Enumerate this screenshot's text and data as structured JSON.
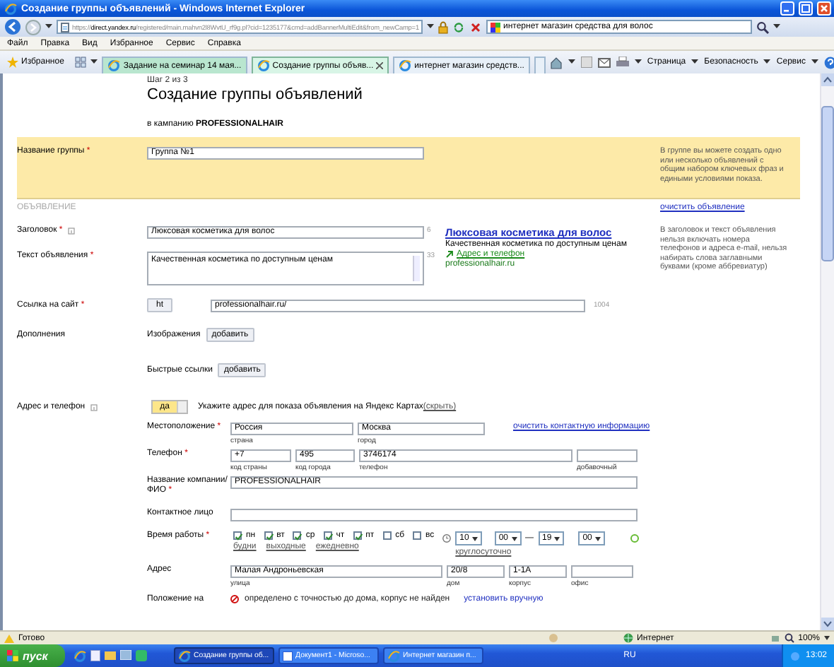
{
  "window": {
    "title": "Создание группы объявлений - Windows Internet Explorer"
  },
  "address_bar": {
    "url_prefix": "https://",
    "url_host": "direct.yandex.ru",
    "url_rest": "/registered/main.mahvn2l8WvtU_rf9g.pl?cid=1235177&cmd=addBannerMultiEdit&from_newCamp=1",
    "search": "интернет магазин средства для волос"
  },
  "menu": [
    "Файл",
    "Правка",
    "Вид",
    "Избранное",
    "Сервис",
    "Справка"
  ],
  "favorites": {
    "label": "Избранное"
  },
  "tabs": [
    {
      "label": "Задание на семинар 14 мая...",
      "selected": false
    },
    {
      "label": "Создание группы объяв...",
      "selected": true
    },
    {
      "label": "интернет магазин средств...",
      "selected": false
    }
  ],
  "command_bar": [
    "Страница",
    "Безопасность",
    "Сервис"
  ],
  "form": {
    "step": "Шаг 2 из 3",
    "heading": "Создание группы объявлений",
    "campaign": "в кампанию **PROFESSIONALHAIR**",
    "group": {
      "label": "Название группы",
      "req": "*",
      "value": "Группа №1",
      "hint": "В группе вы можете создать одно или несколько объявлений с общим набором ключевых фраз и едиными условиями показа."
    },
    "section": "ОБЪЯВЛЕНИЕ",
    "clear_ad": "очистить объявление",
    "title": {
      "label": "Заголовок",
      "req": "*",
      "value": "Люксовая косметика для волос",
      "counter": "6"
    },
    "text": {
      "label": "Текст объявления",
      "req": "*",
      "value": "Качественная косметика по доступным ценам",
      "counter": "33"
    },
    "preview": {
      "title": "Люксовая косметика для волос",
      "text": "Качественная косметика по доступным ценам",
      "contact_link": "Адрес и телефон",
      "domain": "professionalhair.ru"
    },
    "ad_hint": "В заголовок и текст объявления нельзя включать номера телефонов и адреса e-mail, нельзя набирать слова заглавными буквами (кроме аббревиатур)",
    "link": {
      "label": "Ссылка на сайт",
      "req": "*",
      "protocol": "ht",
      "value": "professionalhair.ru/",
      "counter": "1004"
    },
    "extras": {
      "label": "Дополнения",
      "items": [
        {
          "label": "Изображения",
          "button": "добавить"
        },
        {
          "label": "Быстрые ссылки",
          "button": "добавить"
        }
      ]
    },
    "contact": {
      "label": "Адрес и телефон",
      "toggle": {
        "label": "да",
        "on": true
      },
      "prompt": "Укажите адрес для показа объявления на Яндекс Картах",
      "hide": "(скрыть)",
      "clear": "очистить контактную информацию",
      "location": {
        "label": "Местоположение",
        "req": "*",
        "fields": [
          {
            "value": "Россия",
            "caption": "страна"
          },
          {
            "value": "Москва",
            "caption": "город"
          }
        ]
      },
      "phone": {
        "label": "Телефон",
        "req": "*",
        "fields": [
          {
            "value": "+7",
            "caption": "код страны"
          },
          {
            "value": "495",
            "caption": "код города"
          },
          {
            "value": "3746174",
            "caption": "телефон"
          },
          {
            "caption": "добавочный"
          }
        ]
      },
      "company": {
        "label": "Название компании/ФИО",
        "req": "*",
        "value": "PROFESSIONALHAIR"
      },
      "person": {
        "label": "Контактное лицо"
      },
      "hours": {
        "label": "Время работы",
        "req": "*",
        "days": [
          {
            "label": "пн",
            "checked": true
          },
          {
            "label": "вт",
            "checked": true
          },
          {
            "label": "ср",
            "checked": true
          },
          {
            "label": "чт",
            "checked": true
          },
          {
            "label": "пт",
            "checked": true
          },
          {
            "label": "сб",
            "checked": false
          },
          {
            "label": "вс",
            "checked": false
          }
        ],
        "presets": [
          "будни",
          "выходные",
          "ежедневно"
        ],
        "from_h": "10",
        "from_m": "00",
        "dash": "—",
        "to_h": "19",
        "to_m": "00",
        "all_day": "круглосуточно"
      },
      "address": {
        "label": "Адрес",
        "fields": [
          {
            "value": "Малая Андроньевская",
            "caption": "улица"
          },
          {
            "value": "20/8",
            "caption": "дом"
          },
          {
            "value": "1-1А",
            "caption": "корпус"
          },
          {
            "caption": "офис"
          }
        ]
      },
      "map": {
        "label": "Положение на",
        "status": "определено с точностью до дома, корпус не найден",
        "set": "установить вручную"
      }
    }
  },
  "status_bar": {
    "text": "Готово",
    "zone": "Интернет",
    "zoom": "100%"
  },
  "taskbar": {
    "start": "пуск",
    "items": [
      {
        "label": "Создание группы об...",
        "selected": true
      },
      {
        "label": "Документ1 - Microso...",
        "selected": false
      },
      {
        "label": "Интернет магазин п...",
        "selected": false
      }
    ],
    "lang": "RU",
    "clock": "13:02"
  }
}
